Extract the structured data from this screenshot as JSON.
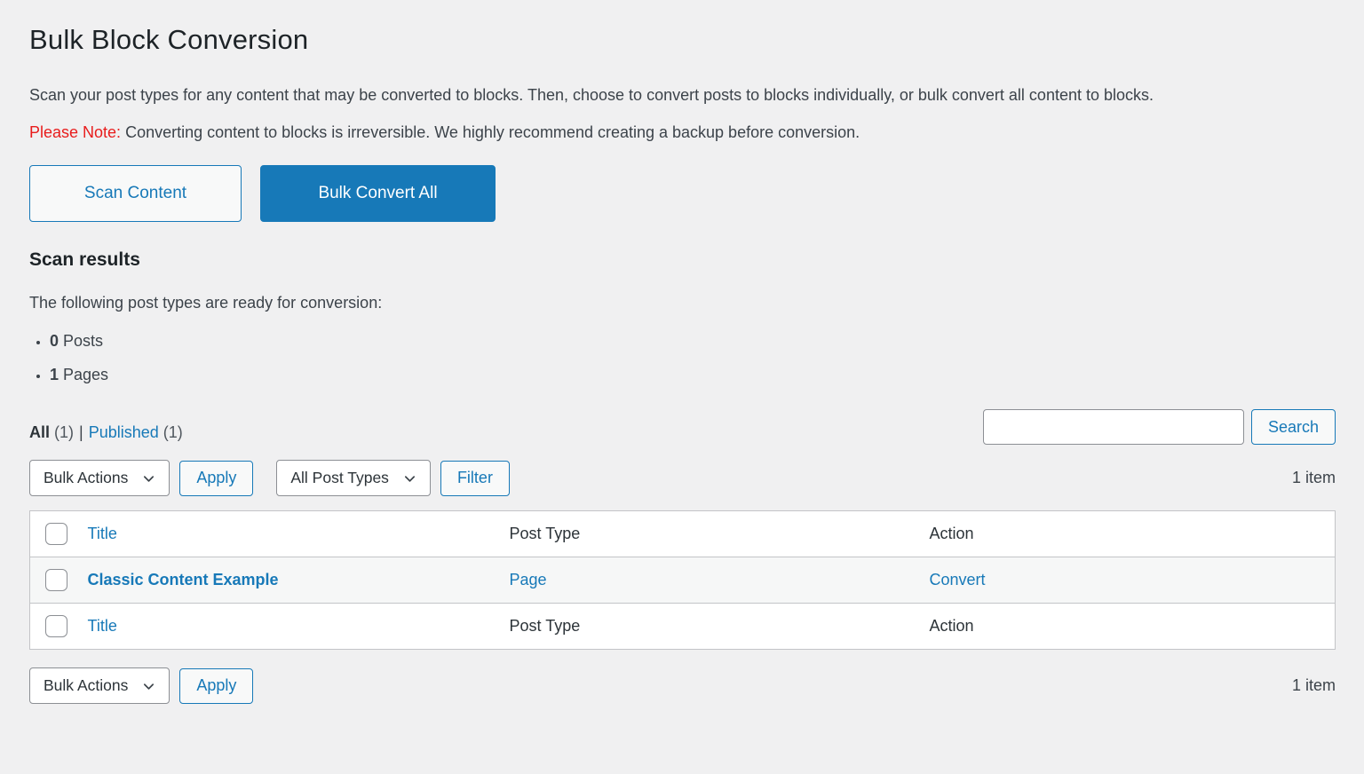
{
  "page": {
    "title": "Bulk Block Conversion",
    "intro": "Scan your post types for any content that may be converted to blocks. Then, choose to convert posts to blocks individually, or bulk convert all content to blocks.",
    "note_label": "Please Note:",
    "note_text": " Converting content to blocks is irreversible. We highly recommend creating a backup before conversion."
  },
  "actions": {
    "scan_button": "Scan Content",
    "bulk_convert_button": "Bulk Convert All"
  },
  "scan_results": {
    "heading": "Scan results",
    "description": "The following post types are ready for conversion:",
    "items": [
      {
        "count": "0",
        "label": " Posts"
      },
      {
        "count": "1",
        "label": " Pages"
      }
    ]
  },
  "views": {
    "all_label": "All",
    "all_count": " (1)",
    "separator": "|",
    "published_label": "Published",
    "published_count": " (1)"
  },
  "toolbar": {
    "search_button": "Search",
    "bulk_actions": "Bulk Actions",
    "apply": "Apply",
    "post_types": "All Post Types",
    "filter": "Filter",
    "item_count": "1 item"
  },
  "table": {
    "headers": {
      "title": "Title",
      "post_type": "Post Type",
      "action": "Action"
    },
    "rows": [
      {
        "title": "Classic Content Example",
        "post_type": "Page",
        "action": "Convert"
      }
    ]
  },
  "colors": {
    "accent_blue": "#1779b8",
    "note_red": "#e81c1c",
    "page_bg": "#f0f0f1",
    "table_border": "#c3c4c7"
  }
}
